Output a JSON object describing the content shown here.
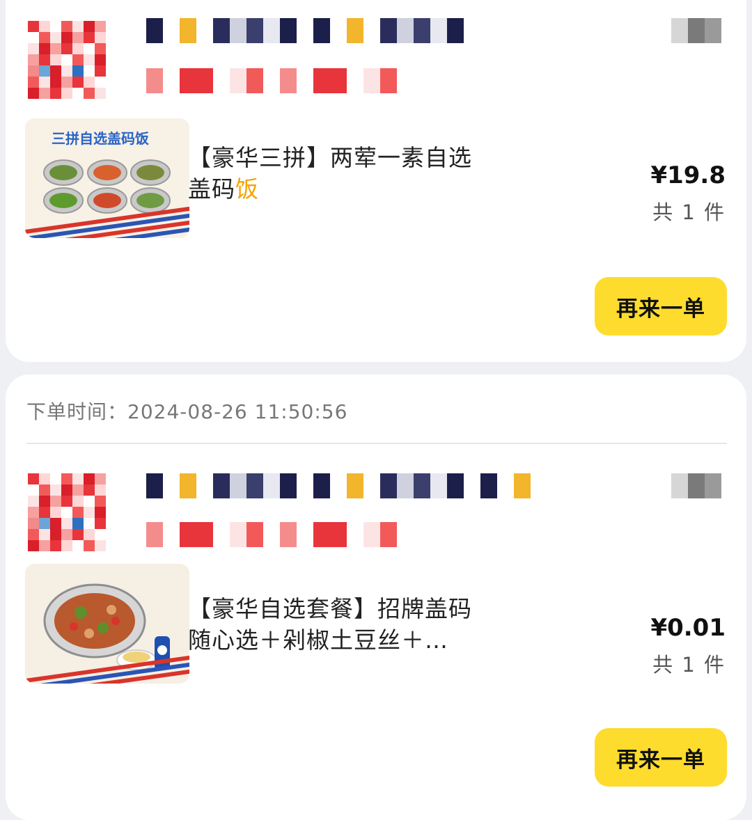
{
  "order_time_label": "下单时间：",
  "orders": [
    {
      "item_title_main": "【豪华三拼】两荤一素自选盖码",
      "item_title_highlight": "饭",
      "thumb_banner_text": "三拼自选盖码饭",
      "price": "¥19.8",
      "count": "共 1 件",
      "reorder_label": "再来一单"
    },
    {
      "order_time": "2024-08-26 11:50:56",
      "item_title_main": "【豪华自选套餐】招牌盖码随心选＋剁椒土豆丝＋…",
      "item_title_highlight": "",
      "price": "¥0.01",
      "count": "共 1 件",
      "reorder_label": "再来一单"
    }
  ],
  "colors": {
    "accent_button": "#fddc2e",
    "highlight_text": "#f5a200",
    "card_background": "#ffffff",
    "page_background": "#eef0f3"
  }
}
